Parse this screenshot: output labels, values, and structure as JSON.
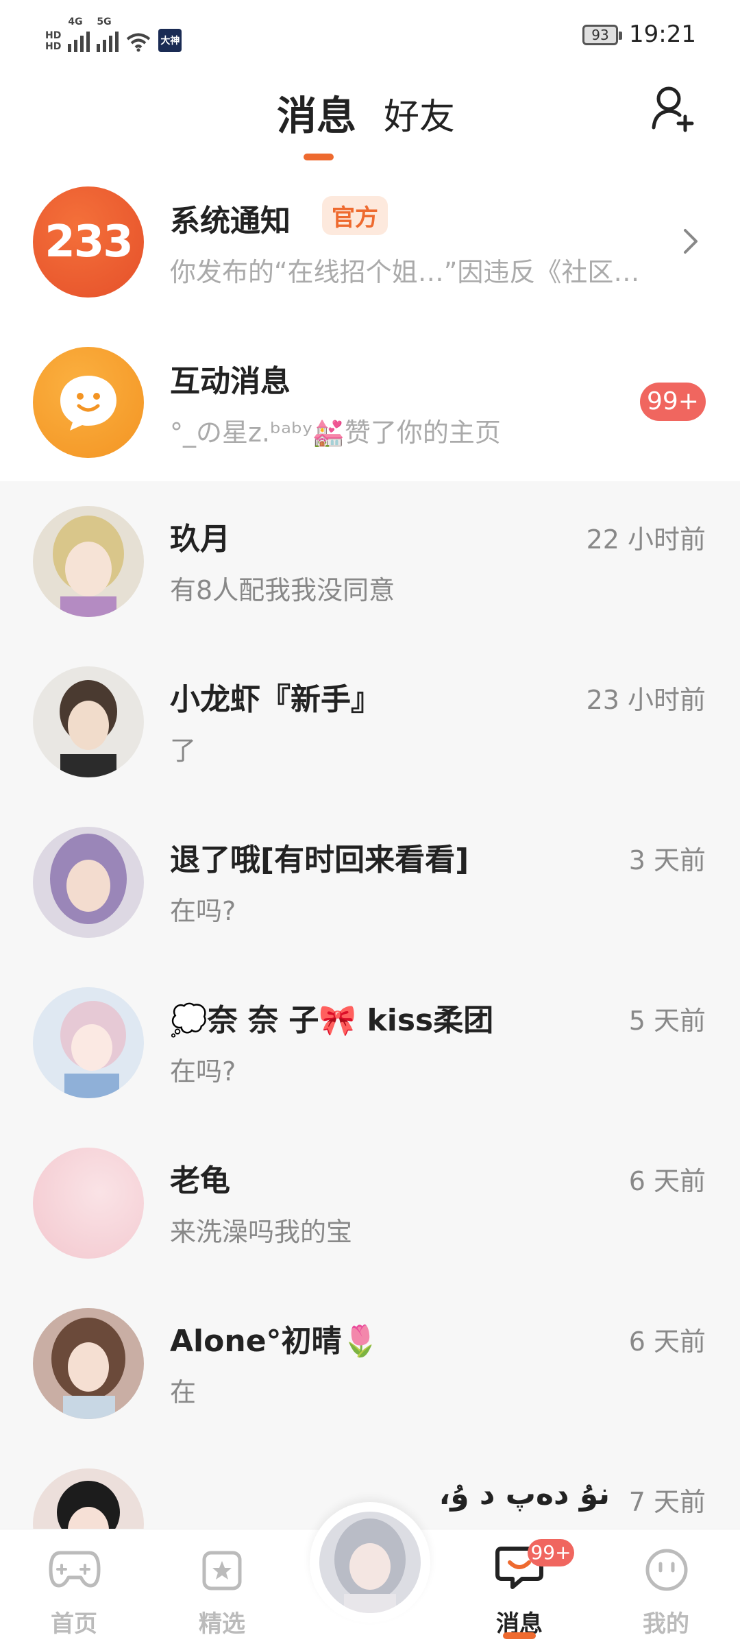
{
  "status_bar": {
    "hd1": "HD",
    "hd2": "HD",
    "net1": "4G",
    "net2": "5G",
    "app_badge": "大神",
    "battery": "93",
    "time": "19:21"
  },
  "header": {
    "tab_messages": "消息",
    "tab_friends": "好友"
  },
  "system": {
    "notification": {
      "avatar_text": "233",
      "title": "系统通知",
      "tag": "官方",
      "preview": "你发布的“在线招个姐…”因违反《社区…"
    },
    "interaction": {
      "title": "互动消息",
      "preview": "°_の星z.ᵇᵃᵇʸ💒赞了你的主页",
      "badge": "99+"
    }
  },
  "chats": [
    {
      "name": "玖月",
      "message": "有8人配我我没同意",
      "time": "22 小时前",
      "avatar_color": "#d6c9a6"
    },
    {
      "name": "小龙虾『新手』",
      "message": "了",
      "time": "23 小时前",
      "avatar_color": "#c9c4bd"
    },
    {
      "name": "退了哦[有时回来看看]",
      "message": "在吗?",
      "time": "3 天前",
      "avatar_color": "#b3a5c9"
    },
    {
      "name": "💭奈 奈 子🎀 kiss柔团",
      "message": "在吗?",
      "time": "5 天前",
      "avatar_color": "#d8d4e6"
    },
    {
      "name": "老龟",
      "message": "来洗澡吗我的宝",
      "time": "6 天前",
      "avatar_color": "#f6d3d8"
    },
    {
      "name": "Alone°初晴🌷",
      "message": "在",
      "time": "6 天前",
      "avatar_color": "#b9a49a"
    },
    {
      "name": "نۇ دەپ د ۇ،",
      "message": "",
      "time": "7 天前",
      "avatar_color": "#d7c6c4"
    }
  ],
  "bottom_nav": {
    "home": "首页",
    "featured": "精选",
    "messages": "消息",
    "messages_badge": "99+",
    "mine": "我的"
  },
  "colors": {
    "accent": "#ee6a2f",
    "badge_red": "#f0665f"
  }
}
